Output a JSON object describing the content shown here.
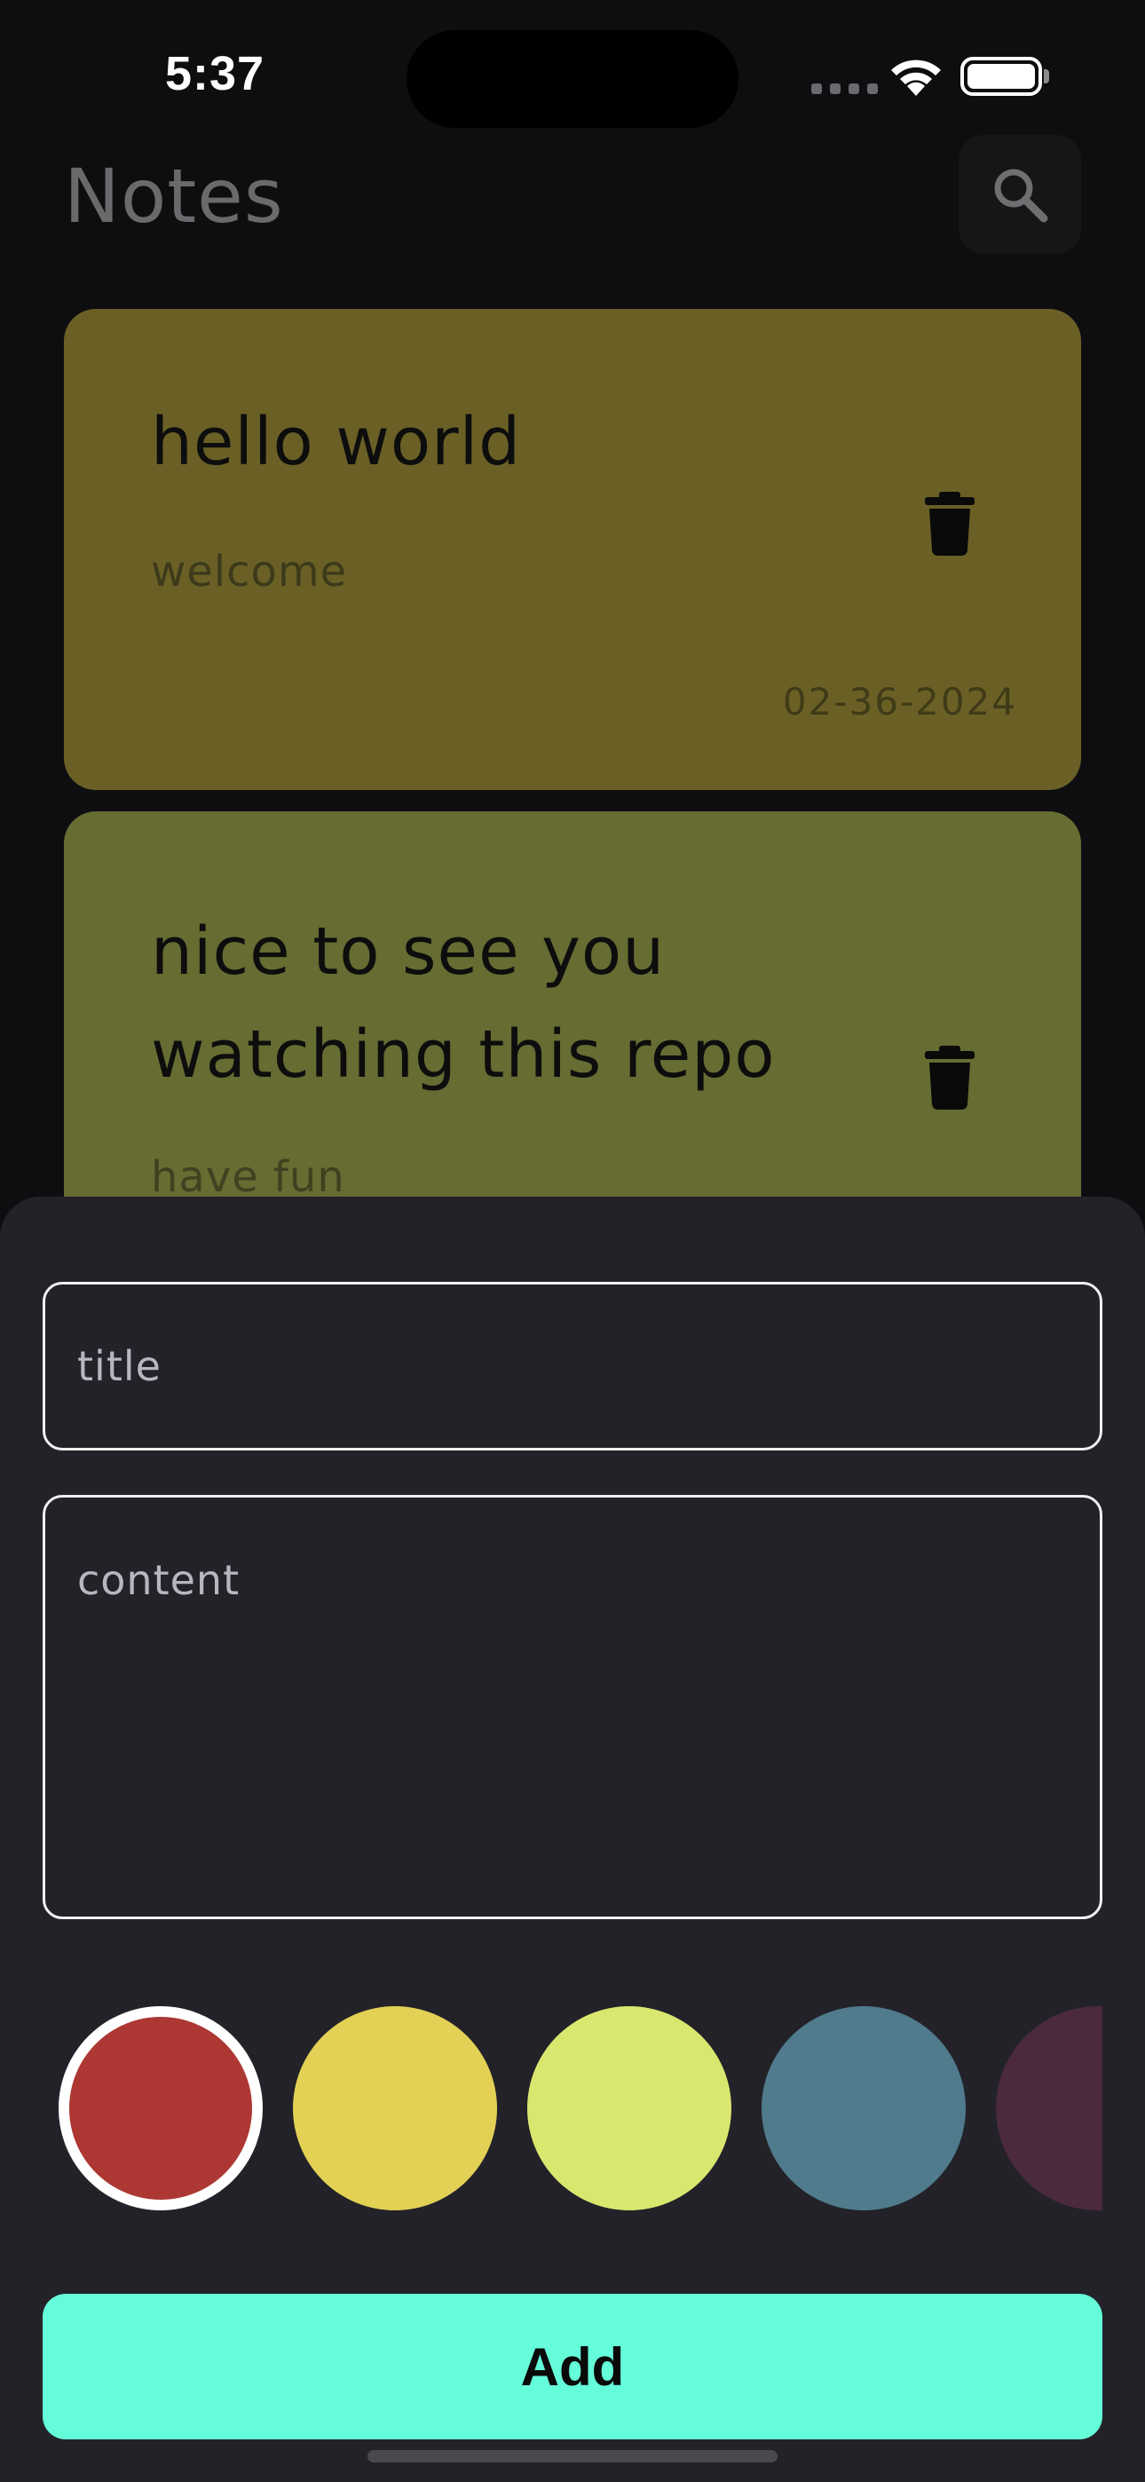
{
  "status_bar": {
    "time": "5:37"
  },
  "header": {
    "title": "Notes",
    "search_icon": "search-icon"
  },
  "notes": [
    {
      "title": "hello world",
      "content": "welcome",
      "date": "02-36-2024",
      "color": "#6a6026"
    },
    {
      "title": "nice to see you watching this repo",
      "content": "have fun",
      "color": "#666c32"
    }
  ],
  "sheet": {
    "title_placeholder": "title",
    "content_placeholder": "content",
    "colors": [
      "#ad3732",
      "#e3d156",
      "#d9e76f",
      "#4f7b8c",
      "#4b2a3f"
    ],
    "selected_color": "#ad3732",
    "add_label": "Add",
    "add_color": "#64fcd9"
  }
}
